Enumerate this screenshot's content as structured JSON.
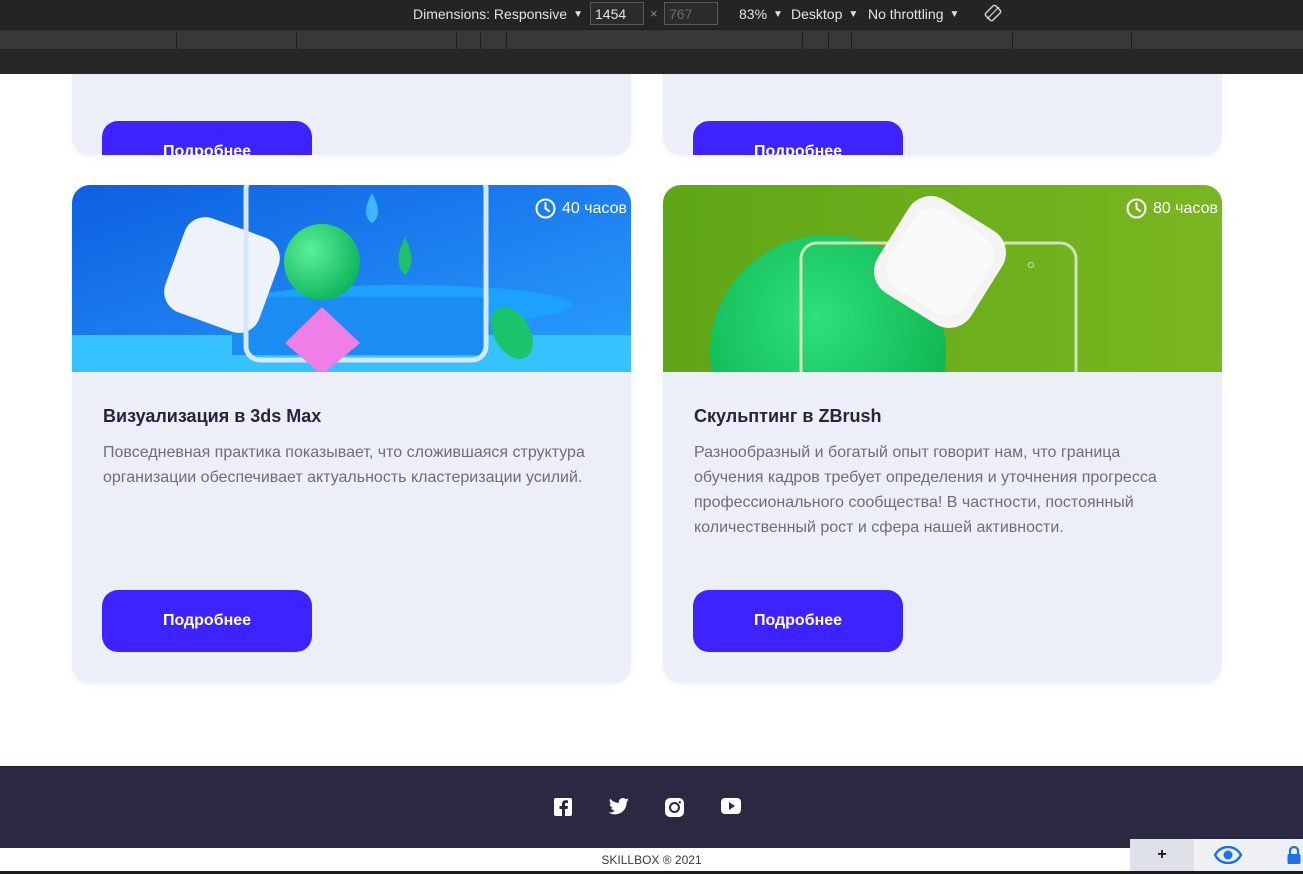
{
  "devtools": {
    "dimensions_label": "Dimensions: Responsive",
    "width_value": "1454",
    "height_value": "767",
    "times": "×",
    "zoom": "83%",
    "device": "Desktop",
    "throttling": "No throttling",
    "rotate_icon": "rotate-icon"
  },
  "top_cards": [
    {
      "button_label": "Подробнее"
    },
    {
      "button_label": "Подробнее"
    }
  ],
  "courses": [
    {
      "hours": "40 часов",
      "title": "Визуализация в 3ds Max",
      "description": "Повседневная практика показывает, что сложившаяся структура организации обеспечивает актуальность кластеризации усилий.",
      "button_label": "Подробнее",
      "image_bg": "#1f7cf0"
    },
    {
      "hours": "80 часов",
      "title": "Скульптинг в ZBrush",
      "description": "Разнообразный и богатый опыт говорит нам, что граница обучения кадров требует определения и уточнения прогресса профессионального сообщества! В частности, постоянный количественный рост и сфера нашей активности.",
      "button_label": "Подробнее",
      "image_bg": "#6fae1e"
    }
  ],
  "footer": {
    "social_icons": [
      "facebook-icon",
      "twitter-icon",
      "instagram-icon",
      "youtube-icon"
    ],
    "copyright": "SKILLBOX ® 2021"
  },
  "widget": {
    "plus": "+",
    "eye_icon": "eye-icon",
    "lock_icon": "lock-icon"
  },
  "colors": {
    "accent": "#3d23ff",
    "card_bg": "#eceef8",
    "footer_bg": "#2b2942",
    "title": "#26243c",
    "text": "#6e6d78"
  }
}
